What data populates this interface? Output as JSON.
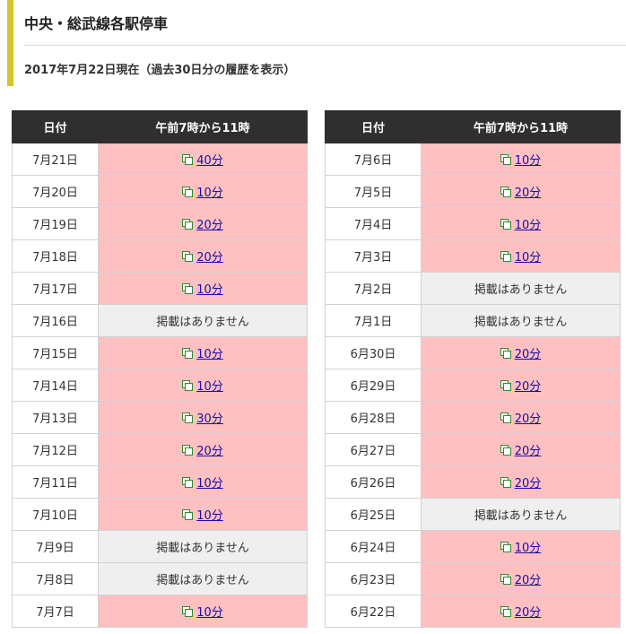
{
  "page": {
    "title": "中央・総武線各駅停車",
    "subtitle": "2017年7月22日現在（過去30日分の履歴を表示）"
  },
  "table_headers": {
    "date": "日付",
    "time": "午前7時から11時"
  },
  "left_rows": [
    {
      "date": "7月21日",
      "status": "40分"
    },
    {
      "date": "7月20日",
      "status": "10分"
    },
    {
      "date": "7月19日",
      "status": "20分"
    },
    {
      "date": "7月18日",
      "status": "20分"
    },
    {
      "date": "7月17日",
      "status": "10分"
    },
    {
      "date": "7月16日",
      "status": "掲載はありません"
    },
    {
      "date": "7月15日",
      "status": "10分"
    },
    {
      "date": "7月14日",
      "status": "10分"
    },
    {
      "date": "7月13日",
      "status": "30分"
    },
    {
      "date": "7月12日",
      "status": "20分"
    },
    {
      "date": "7月11日",
      "status": "10分"
    },
    {
      "date": "7月10日",
      "status": "10分"
    },
    {
      "date": "7月9日",
      "status": "掲載はありません"
    },
    {
      "date": "7月8日",
      "status": "掲載はありません"
    },
    {
      "date": "7月7日",
      "status": "10分"
    }
  ],
  "right_rows": [
    {
      "date": "7月6日",
      "status": "10分"
    },
    {
      "date": "7月5日",
      "status": "20分"
    },
    {
      "date": "7月4日",
      "status": "10分"
    },
    {
      "date": "7月3日",
      "status": "10分"
    },
    {
      "date": "7月2日",
      "status": "掲載はありません"
    },
    {
      "date": "7月1日",
      "status": "掲載はありません"
    },
    {
      "date": "6月30日",
      "status": "20分"
    },
    {
      "date": "6月29日",
      "status": "20分"
    },
    {
      "date": "6月28日",
      "status": "20分"
    },
    {
      "date": "6月27日",
      "status": "20分"
    },
    {
      "date": "6月26日",
      "status": "20分"
    },
    {
      "date": "6月25日",
      "status": "掲載はありません"
    },
    {
      "date": "6月24日",
      "status": "10分"
    },
    {
      "date": "6月23日",
      "status": "20分"
    },
    {
      "date": "6月22日",
      "status": "20分"
    }
  ],
  "no_info_text": "掲載はありません",
  "colors": {
    "accent_bar": "#d8c42a",
    "header_bg": "#2f2f2f",
    "delay_bg": "#ffc0c2",
    "none_bg": "#efefef",
    "link": "#1a0dab",
    "icon": "#2e8b2e"
  },
  "icons": {
    "delay_link": "window-copy-icon"
  }
}
